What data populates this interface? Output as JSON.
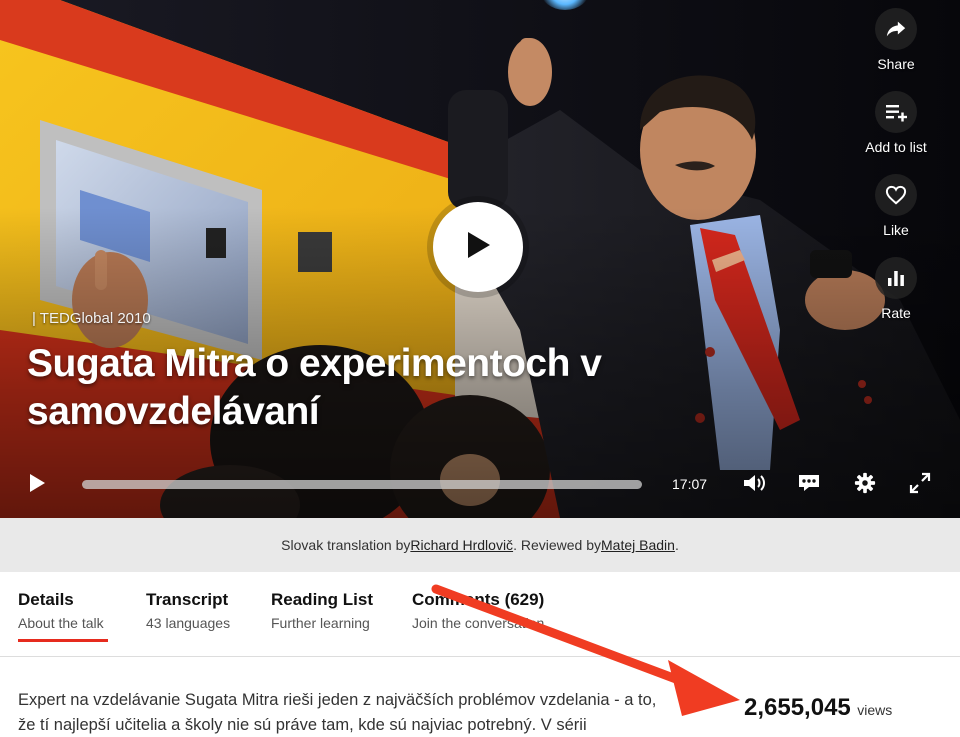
{
  "video": {
    "event": "| TEDGlobal 2010",
    "title": "Sugata Mitra o experimentoch v samovzdelávaní",
    "duration": "17:07",
    "progress_fraction": 0.0
  },
  "side_actions": [
    {
      "label": "Share",
      "icon": "share-icon"
    },
    {
      "label": "Add to list",
      "icon": "add-to-list-icon"
    },
    {
      "label": "Like",
      "icon": "heart-icon"
    },
    {
      "label": "Rate",
      "icon": "bar-chart-icon"
    }
  ],
  "translation": {
    "prefix": "Slovak translation by ",
    "translator": "Richard Hrdlovič",
    "middle": ". Reviewed by ",
    "reviewer": "Matej Badin",
    "suffix": "."
  },
  "tabs": [
    {
      "title": "Details",
      "subtitle": "About the talk",
      "active": true
    },
    {
      "title": "Transcript",
      "subtitle": "43 languages",
      "active": false
    },
    {
      "title": "Reading List",
      "subtitle": "Further learning",
      "active": false
    },
    {
      "title": "Comments (629)",
      "subtitle": "Join the conversation",
      "active": false
    }
  ],
  "description": {
    "line1": "Expert na vzdelávanie Sugata Mitra rieši jeden z najväčších problémov vzdelania - a to,",
    "line2": "že tí najlepší učitelia a školy nie sú práve tam, kde sú najviac potrebný. V sérii"
  },
  "stats": {
    "views_count": "2,655,045",
    "views_label": "views"
  },
  "colors": {
    "accent": "#e62b1e",
    "annotation_arrow": "#f03c22"
  }
}
